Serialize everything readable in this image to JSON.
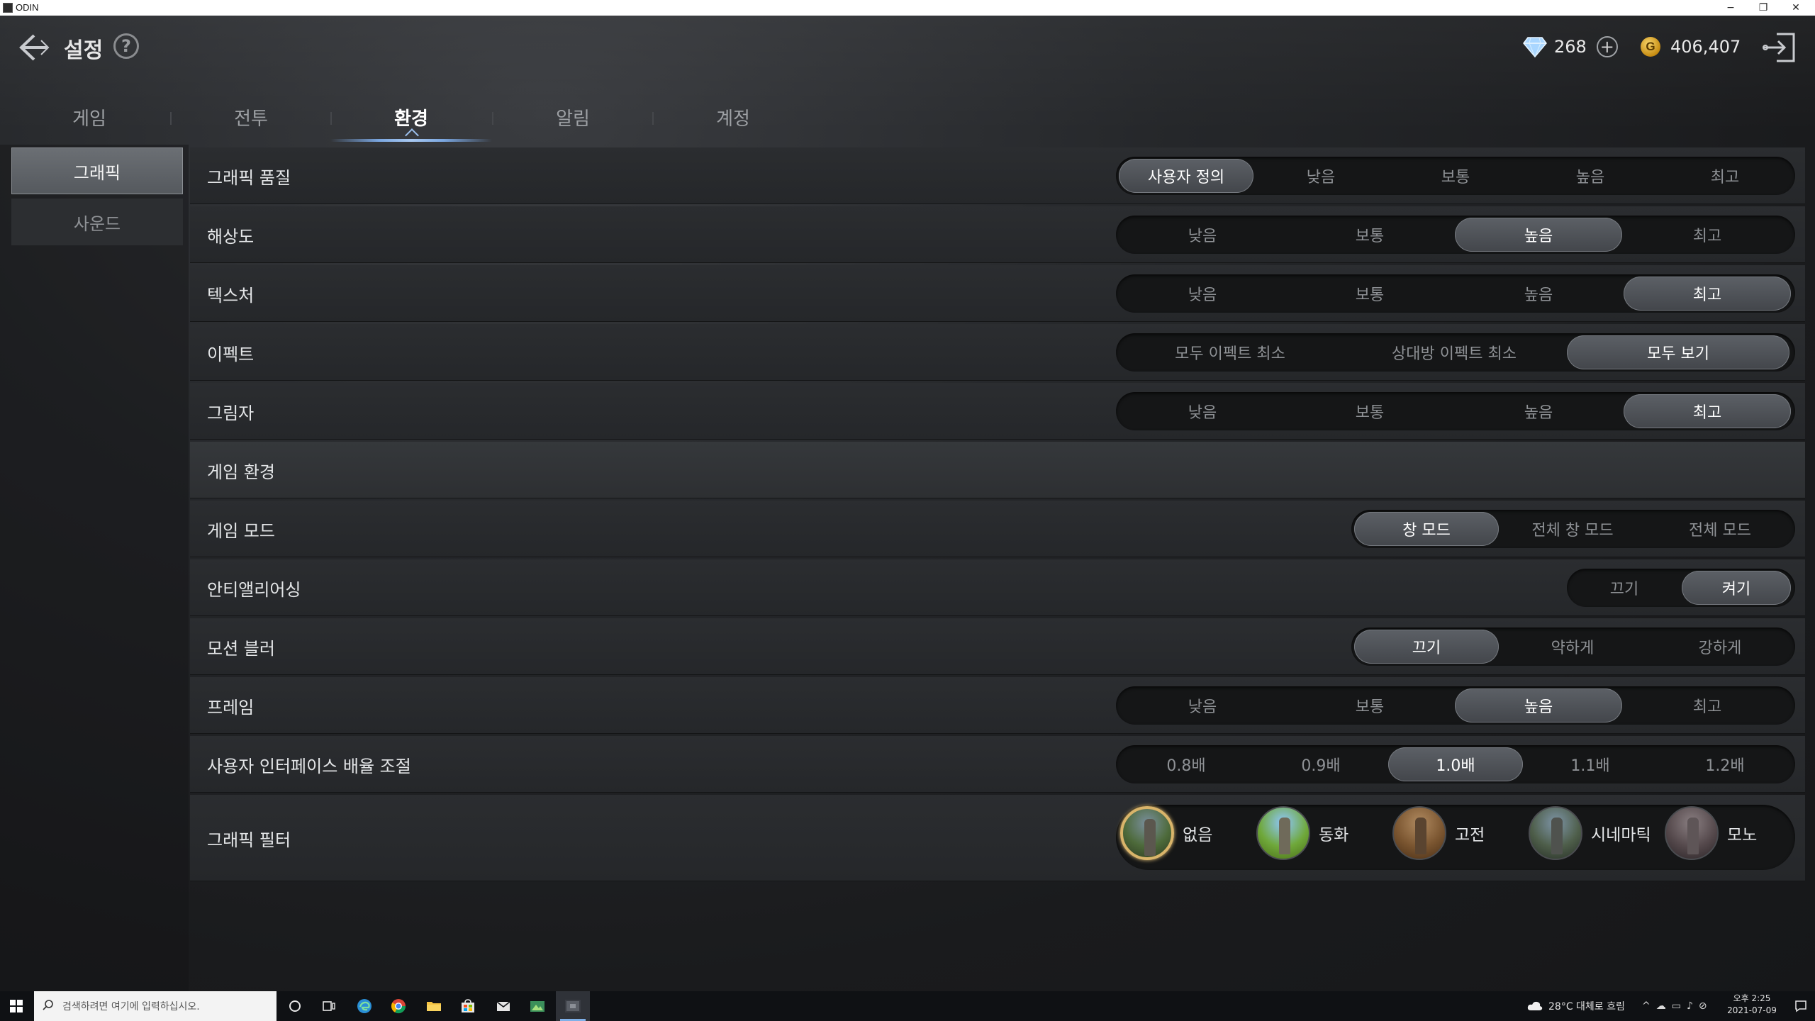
{
  "window": {
    "title": "ODIN",
    "minimize": "−",
    "restore": "❐",
    "close": "✕"
  },
  "header": {
    "title": "설정",
    "help": "?",
    "diamond": "268",
    "add": "+",
    "gold_symbol": "G",
    "gold": "406,407"
  },
  "tabs": [
    {
      "label": "게임"
    },
    {
      "label": "전투"
    },
    {
      "label": "환경"
    },
    {
      "label": "알림"
    },
    {
      "label": "계정"
    }
  ],
  "active_tab": "환경",
  "sidenav": [
    {
      "label": "그래픽"
    },
    {
      "label": "사운드"
    }
  ],
  "settings": {
    "quality": {
      "label": "그래픽 품질",
      "options": [
        "사용자 정의",
        "낮음",
        "보통",
        "높음",
        "최고"
      ],
      "selected": "사용자 정의"
    },
    "resolution": {
      "label": "해상도",
      "options": [
        "낮음",
        "보통",
        "높음",
        "최고"
      ],
      "selected": "높음"
    },
    "texture": {
      "label": "텍스처",
      "options": [
        "낮음",
        "보통",
        "높음",
        "최고"
      ],
      "selected": "최고"
    },
    "effect": {
      "label": "이펙트",
      "options": [
        "모두 이펙트 최소",
        "상대방 이펙트 최소",
        "모두 보기"
      ],
      "selected": "모두 보기"
    },
    "shadow": {
      "label": "그림자",
      "options": [
        "낮음",
        "보통",
        "높음",
        "최고"
      ],
      "selected": "최고"
    },
    "section_game_env": "게임 환경",
    "game_mode": {
      "label": "게임 모드",
      "options": [
        "창 모드",
        "전체 창 모드",
        "전체 모드"
      ],
      "selected": "창 모드"
    },
    "antialiasing": {
      "label": "안티앨리어싱",
      "options": [
        "끄기",
        "켜기"
      ],
      "selected": "켜기"
    },
    "motion_blur": {
      "label": "모션 블러",
      "options": [
        "끄기",
        "약하게",
        "강하게"
      ],
      "selected": "끄기"
    },
    "frame": {
      "label": "프레임",
      "options": [
        "낮음",
        "보통",
        "높음",
        "최고"
      ],
      "selected": "높음"
    },
    "ui_scale": {
      "label": "사용자 인터페이스 배율 조절",
      "options": [
        "0.8배",
        "0.9배",
        "1.0배",
        "1.1배",
        "1.2배"
      ],
      "selected": "1.0배"
    },
    "filter": {
      "label": "그래픽 필터",
      "options": [
        "없음",
        "동화",
        "고전",
        "시네마틱",
        "모노"
      ],
      "selected": "없음"
    }
  },
  "taskbar": {
    "search_placeholder": "검색하려면 여기에 입력하십시오.",
    "weather": "28°C 대체로 흐림",
    "tray_chevron": "^",
    "time": "오후 2:25",
    "date": "2021-07-09"
  },
  "colors": {
    "accent_tab": "#7aa6e0",
    "filter_selected_ring": "#d9b46a",
    "gold": "#c68c12",
    "diamond": "#9fd0ff"
  }
}
